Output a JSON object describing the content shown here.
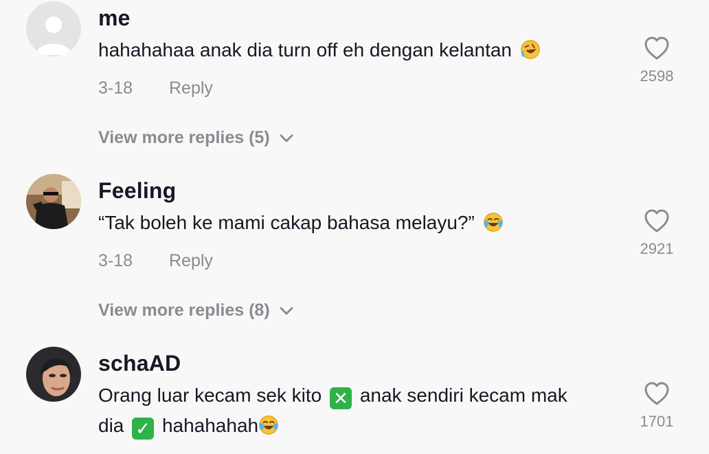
{
  "comments": [
    {
      "username": "me",
      "text": "hahahahaa anak dia turn off eh dengan kelantan",
      "text_emoji": "rolling-on-floor-laughing-emoji",
      "date": "3-18",
      "reply_label": "Reply",
      "likes": "2598",
      "view_more": "View more replies (5)",
      "avatar": "default-avatar"
    },
    {
      "username": "Feeling",
      "text": "“Tak boleh ke mami cakap bahasa melayu?”",
      "text_emoji": "tears-of-joy-emoji",
      "date": "3-18",
      "reply_label": "Reply",
      "likes": "2921",
      "view_more": "View more replies (8)",
      "avatar": "photo-avatar"
    },
    {
      "username": "schaAD",
      "text_part1": "Orang luar kecam sek kito",
      "text_part2": "anak sendiri kecam mak",
      "text_part3": "dia",
      "text_part4": "hahahahah",
      "x_mark": "✕",
      "check_mark": "✓",
      "likes": "1701",
      "avatar": "photo-avatar"
    }
  ],
  "colors": {
    "background": "#f8f8f8",
    "primary_text": "#161823",
    "secondary_text": "#8a8b91",
    "box_emoji": "#2fb24a"
  }
}
